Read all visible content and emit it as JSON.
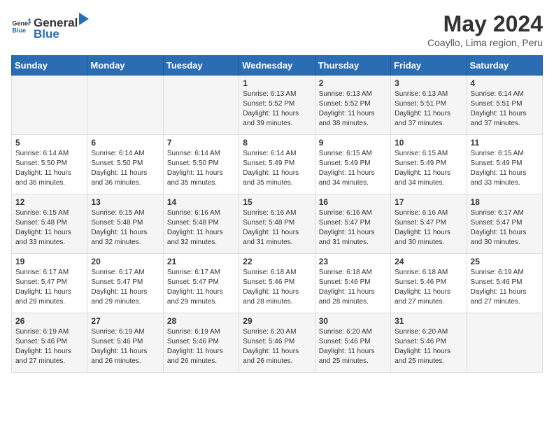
{
  "header": {
    "logo_general": "General",
    "logo_blue": "Blue",
    "title": "May 2024",
    "subtitle": "Coayllo, Lima region, Peru"
  },
  "days_of_week": [
    "Sunday",
    "Monday",
    "Tuesday",
    "Wednesday",
    "Thursday",
    "Friday",
    "Saturday"
  ],
  "weeks": [
    [
      {
        "day": "",
        "info": ""
      },
      {
        "day": "",
        "info": ""
      },
      {
        "day": "",
        "info": ""
      },
      {
        "day": "1",
        "info": "Sunrise: 6:13 AM\nSunset: 5:52 PM\nDaylight: 11 hours and 39 minutes."
      },
      {
        "day": "2",
        "info": "Sunrise: 6:13 AM\nSunset: 5:52 PM\nDaylight: 11 hours and 38 minutes."
      },
      {
        "day": "3",
        "info": "Sunrise: 6:13 AM\nSunset: 5:51 PM\nDaylight: 11 hours and 37 minutes."
      },
      {
        "day": "4",
        "info": "Sunrise: 6:14 AM\nSunset: 5:51 PM\nDaylight: 11 hours and 37 minutes."
      }
    ],
    [
      {
        "day": "5",
        "info": "Sunrise: 6:14 AM\nSunset: 5:50 PM\nDaylight: 11 hours and 36 minutes."
      },
      {
        "day": "6",
        "info": "Sunrise: 6:14 AM\nSunset: 5:50 PM\nDaylight: 11 hours and 36 minutes."
      },
      {
        "day": "7",
        "info": "Sunrise: 6:14 AM\nSunset: 5:50 PM\nDaylight: 11 hours and 35 minutes."
      },
      {
        "day": "8",
        "info": "Sunrise: 6:14 AM\nSunset: 5:49 PM\nDaylight: 11 hours and 35 minutes."
      },
      {
        "day": "9",
        "info": "Sunrise: 6:15 AM\nSunset: 5:49 PM\nDaylight: 11 hours and 34 minutes."
      },
      {
        "day": "10",
        "info": "Sunrise: 6:15 AM\nSunset: 5:49 PM\nDaylight: 11 hours and 34 minutes."
      },
      {
        "day": "11",
        "info": "Sunrise: 6:15 AM\nSunset: 5:49 PM\nDaylight: 11 hours and 33 minutes."
      }
    ],
    [
      {
        "day": "12",
        "info": "Sunrise: 6:15 AM\nSunset: 5:48 PM\nDaylight: 11 hours and 33 minutes."
      },
      {
        "day": "13",
        "info": "Sunrise: 6:15 AM\nSunset: 5:48 PM\nDaylight: 11 hours and 32 minutes."
      },
      {
        "day": "14",
        "info": "Sunrise: 6:16 AM\nSunset: 5:48 PM\nDaylight: 11 hours and 32 minutes."
      },
      {
        "day": "15",
        "info": "Sunrise: 6:16 AM\nSunset: 5:48 PM\nDaylight: 11 hours and 31 minutes."
      },
      {
        "day": "16",
        "info": "Sunrise: 6:16 AM\nSunset: 5:47 PM\nDaylight: 11 hours and 31 minutes."
      },
      {
        "day": "17",
        "info": "Sunrise: 6:16 AM\nSunset: 5:47 PM\nDaylight: 11 hours and 30 minutes."
      },
      {
        "day": "18",
        "info": "Sunrise: 6:17 AM\nSunset: 5:47 PM\nDaylight: 11 hours and 30 minutes."
      }
    ],
    [
      {
        "day": "19",
        "info": "Sunrise: 6:17 AM\nSunset: 5:47 PM\nDaylight: 11 hours and 29 minutes."
      },
      {
        "day": "20",
        "info": "Sunrise: 6:17 AM\nSunset: 5:47 PM\nDaylight: 11 hours and 29 minutes."
      },
      {
        "day": "21",
        "info": "Sunrise: 6:17 AM\nSunset: 5:47 PM\nDaylight: 11 hours and 29 minutes."
      },
      {
        "day": "22",
        "info": "Sunrise: 6:18 AM\nSunset: 5:46 PM\nDaylight: 11 hours and 28 minutes."
      },
      {
        "day": "23",
        "info": "Sunrise: 6:18 AM\nSunset: 5:46 PM\nDaylight: 11 hours and 28 minutes."
      },
      {
        "day": "24",
        "info": "Sunrise: 6:18 AM\nSunset: 5:46 PM\nDaylight: 11 hours and 27 minutes."
      },
      {
        "day": "25",
        "info": "Sunrise: 6:19 AM\nSunset: 5:46 PM\nDaylight: 11 hours and 27 minutes."
      }
    ],
    [
      {
        "day": "26",
        "info": "Sunrise: 6:19 AM\nSunset: 5:46 PM\nDaylight: 11 hours and 27 minutes."
      },
      {
        "day": "27",
        "info": "Sunrise: 6:19 AM\nSunset: 5:46 PM\nDaylight: 11 hours and 26 minutes."
      },
      {
        "day": "28",
        "info": "Sunrise: 6:19 AM\nSunset: 5:46 PM\nDaylight: 11 hours and 26 minutes."
      },
      {
        "day": "29",
        "info": "Sunrise: 6:20 AM\nSunset: 5:46 PM\nDaylight: 11 hours and 26 minutes."
      },
      {
        "day": "30",
        "info": "Sunrise: 6:20 AM\nSunset: 5:46 PM\nDaylight: 11 hours and 25 minutes."
      },
      {
        "day": "31",
        "info": "Sunrise: 6:20 AM\nSunset: 5:46 PM\nDaylight: 11 hours and 25 minutes."
      },
      {
        "day": "",
        "info": ""
      }
    ]
  ]
}
